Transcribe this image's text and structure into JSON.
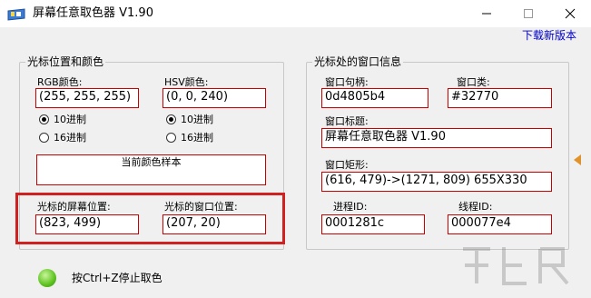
{
  "window": {
    "title": "屏幕任意取色器 V1.90",
    "minimize_icon": "minimize-icon",
    "maximize_icon": "maximize-icon",
    "close_icon": "close-icon"
  },
  "header": {
    "update_link": "下载新版本"
  },
  "cursor_group": {
    "legend": "光标位置和颜色",
    "rgb": {
      "label": "RGB颜色:",
      "value": "(255, 255, 255)",
      "radio_10": "10进制",
      "radio_16": "16进制",
      "selected": "10进制"
    },
    "hsv": {
      "label": "HSV颜色:",
      "value": "(0, 0, 240)",
      "radio_10": "10进制",
      "radio_16": "16进制",
      "selected": "10进制"
    },
    "sample_label": "当前颜色样本",
    "sample_color": "#ffffff",
    "screen_pos": {
      "label": "光标的屏幕位置:",
      "value": "(823, 499)"
    },
    "window_pos": {
      "label": "光标的窗口位置:",
      "value": "(207, 20)"
    }
  },
  "window_group": {
    "legend": "光标处的窗口信息",
    "handle": {
      "label": "窗口句柄:",
      "value": "0d4805b4"
    },
    "class": {
      "label": "窗口类:",
      "value": "#32770"
    },
    "caption": {
      "label": "窗口标题:",
      "value": "屏幕任意取色器 V1.90"
    },
    "rect": {
      "label": "窗口矩形:",
      "value": "(616, 479)->(1271, 809) 655X330"
    },
    "process": {
      "label": "进程ID:",
      "value": "0001281c"
    },
    "thread": {
      "label": "线程ID:",
      "value": "000077e4"
    }
  },
  "status": {
    "hint": "按Ctrl+Z停止取色",
    "led_color": "#5cc21e"
  },
  "colors": {
    "accent_red": "#c80000",
    "highlight": "#d02020",
    "link": "#0000cc"
  }
}
